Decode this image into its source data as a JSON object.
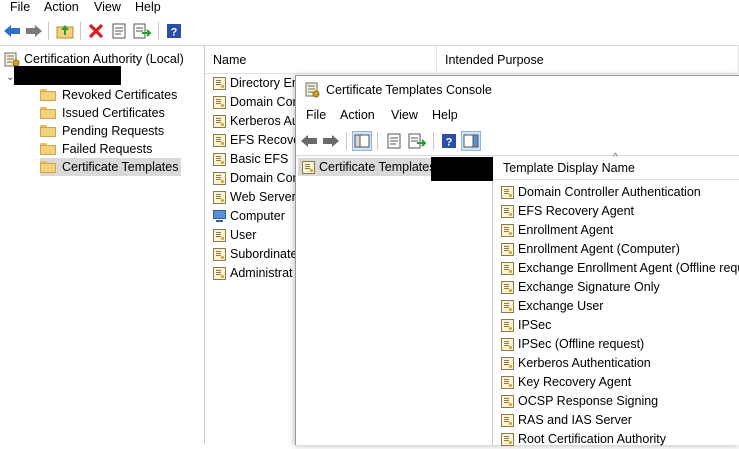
{
  "menubar": {
    "file": "File",
    "action": "Action",
    "view": "View",
    "help": "Help"
  },
  "tree": {
    "root_label": "Certification Authority (Local)",
    "items": [
      {
        "label": "Revoked Certificates"
      },
      {
        "label": "Issued Certificates"
      },
      {
        "label": "Pending Requests"
      },
      {
        "label": "Failed Requests"
      },
      {
        "label": "Certificate Templates"
      }
    ]
  },
  "list": {
    "columns": [
      "Name",
      "Intended Purpose"
    ],
    "rows": [
      "Directory Em",
      "Domain Con",
      "Kerberos Au",
      "EFS Recover",
      "Basic EFS",
      "Domain Con",
      "Web Server",
      "Computer",
      "User",
      "Subordinate",
      "Administrat"
    ]
  },
  "console": {
    "title": "Certificate Templates Console",
    "menubar": {
      "file": "File",
      "action": "Action",
      "view": "View",
      "help": "Help"
    },
    "tree_label": "Certificate Templates",
    "column_header": "Template Display Name",
    "templates": [
      "Domain Controller Authentication",
      "EFS Recovery Agent",
      "Enrollment Agent",
      "Enrollment Agent (Computer)",
      "Exchange Enrollment Agent (Offline requ...",
      "Exchange Signature Only",
      "Exchange User",
      "IPSec",
      "IPSec (Offline request)",
      "Kerberos Authentication",
      "Key Recovery Agent",
      "OCSP Response Signing",
      "RAS and IAS Server",
      "Root Certification Authority"
    ]
  }
}
